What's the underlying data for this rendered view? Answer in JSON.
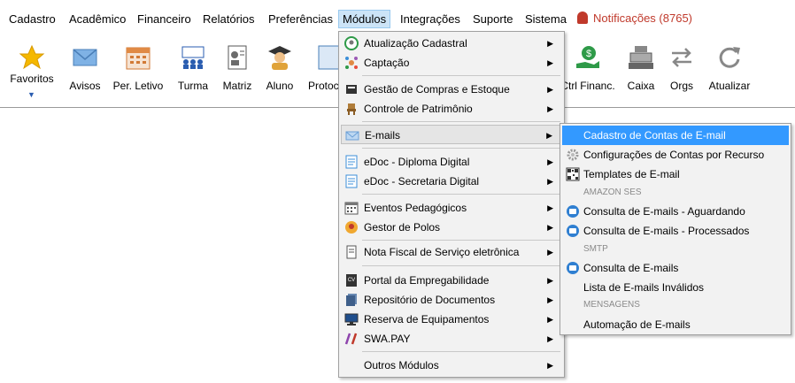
{
  "menubar": {
    "items": [
      "Cadastro",
      "Acadêmico",
      "Financeiro",
      "Relatórios",
      "Preferências",
      "Módulos",
      "Integrações",
      "Suporte",
      "Sistema"
    ],
    "notifications": "Notificações (8765)"
  },
  "toolbar": {
    "favoritos": "Favoritos",
    "avisos": "Avisos",
    "per_letivo": "Per. Letivo",
    "turma": "Turma",
    "matriz": "Matriz",
    "aluno": "Aluno",
    "protocolo": "Protoc",
    "ctrl_financ": "Ctrl Financ.",
    "caixa": "Caixa",
    "orgs": "Orgs",
    "atualizar": "Atualizar"
  },
  "modulos_menu": {
    "items": [
      {
        "label": "Atualização Cadastral"
      },
      {
        "label": "Captação"
      },
      {
        "label": "Gestão de Compras e Estoque"
      },
      {
        "label": "Controle de Patrimônio"
      },
      {
        "label": "E-mails"
      },
      {
        "label": "eDoc - Diploma Digital"
      },
      {
        "label": "eDoc - Secretaria Digital"
      },
      {
        "label": "Eventos Pedagógicos"
      },
      {
        "label": "Gestor de Polos"
      },
      {
        "label": "Nota Fiscal de Serviço eletrônica"
      },
      {
        "label": "Portal da Empregabilidade"
      },
      {
        "label": "Repositório de Documentos"
      },
      {
        "label": "Reserva de Equipamentos"
      },
      {
        "label": "SWA.PAY"
      },
      {
        "label": "Outros Módulos"
      }
    ]
  },
  "emails_submenu": {
    "items": [
      "Cadastro de Contas de E-mail",
      "Configurações de Contas por Recurso",
      "Templates de E-mail",
      "Consulta de E-mails - Aguardando",
      "Consulta de E-mails - Processados",
      "Consulta de E-mails",
      "Lista de E-mails Inválidos",
      "Automação de E-mails"
    ],
    "headers": [
      "AMAZON SES",
      "SMTP",
      "MENSAGENS"
    ]
  },
  "colors": {
    "highlight": "#3399ff",
    "notification": "#c0392b",
    "menu_bg": "#f2f2f2"
  }
}
